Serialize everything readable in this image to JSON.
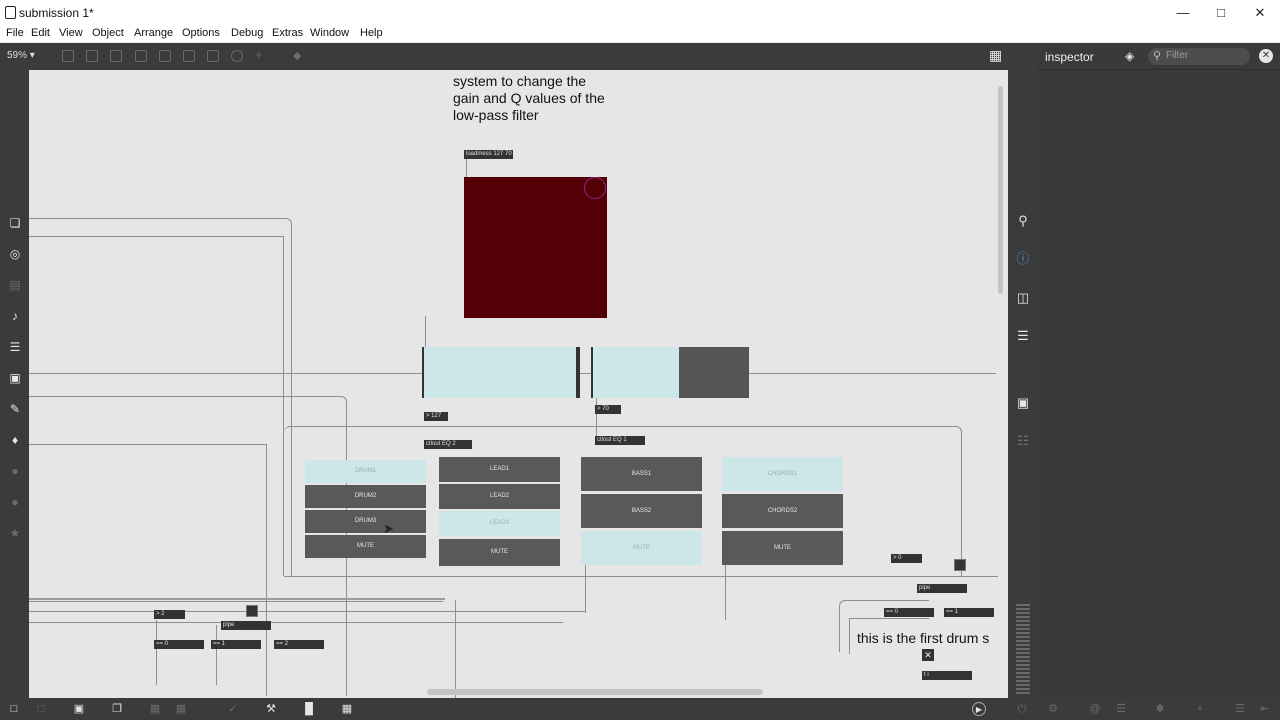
{
  "window": {
    "title": "submission 1*",
    "controls": [
      "minimize-icon",
      "maximize-icon",
      "close-icon"
    ]
  },
  "menu": [
    "File",
    "Edit",
    "View",
    "Object",
    "Arrange",
    "Options",
    "Debug",
    "Extras",
    "Window",
    "Help"
  ],
  "toolbar": {
    "zoom": "59% ▾"
  },
  "inspector": {
    "title": "inspector",
    "filter_placeholder": "Filter"
  },
  "patch": {
    "comment_top": "system to change the\ngain and Q values of the\nlow-pass filter",
    "comment_drum": "this is the first drum s",
    "messages": {
      "bpm": "loadmess 127 70",
      "gt127": "> 127",
      "ctlout1": "ctlout EQ 2",
      "gt70": "> 70",
      "ctlout2": "ctlout EQ 1",
      "p0": "> 0",
      "pipe1": "pipe",
      "eq0": "== 0",
      "eq1": "== 1",
      "a2": "> 2",
      "pipe2": "pipe",
      "b0": "== 0",
      "b1": "== 1",
      "b2": "== 2",
      "bottom1": "t i"
    },
    "drum": [
      "DRUM1",
      "DRUM2",
      "DRUM3",
      "MUTE"
    ],
    "lead": [
      "LEAD1",
      "LEAD2",
      "LEAD3",
      "MUTE"
    ],
    "bass": [
      "BASS1",
      "BASS2",
      "MUTE"
    ],
    "chords": [
      "CHORDS1",
      "CHORDS2",
      "MUTE"
    ],
    "colors": {
      "lcd": "#520006",
      "toggle_on": "#cde6e7",
      "toggle_off": "#595959"
    }
  }
}
